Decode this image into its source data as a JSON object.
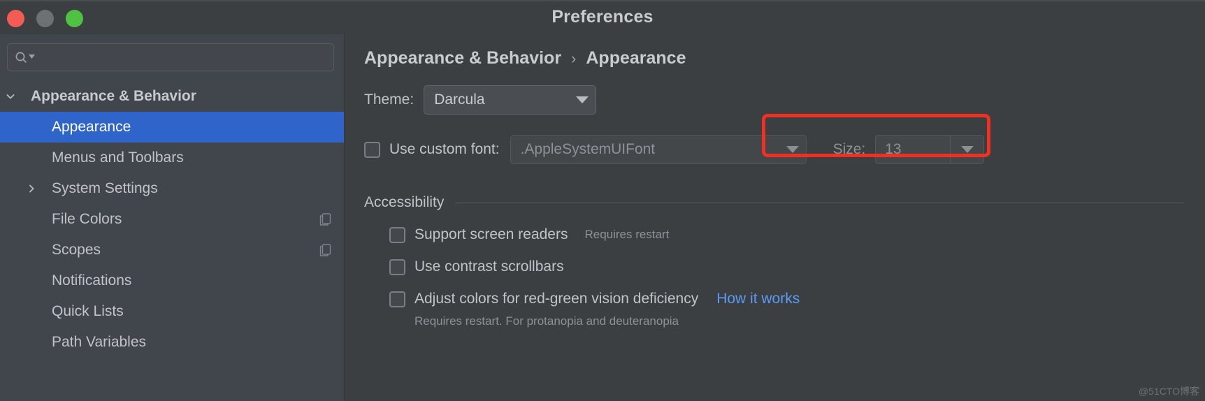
{
  "window": {
    "title": "Preferences",
    "traffic_lights": [
      "close-button",
      "minimize-button",
      "maximize-button"
    ]
  },
  "sidebar": {
    "search": {
      "value": "",
      "placeholder": "",
      "icon": "search-icon"
    },
    "items": [
      {
        "label": "Appearance & Behavior",
        "level": "group",
        "expanded": true,
        "arrow": "chevron-down-icon",
        "selected": false,
        "action_icon": ""
      },
      {
        "label": "Appearance",
        "level": "child",
        "expanded": false,
        "arrow": "",
        "selected": true,
        "action_icon": ""
      },
      {
        "label": "Menus and Toolbars",
        "level": "child",
        "expanded": false,
        "arrow": "",
        "selected": false,
        "action_icon": ""
      },
      {
        "label": "System Settings",
        "level": "child",
        "expanded": false,
        "arrow": "chevron-right-icon",
        "selected": false,
        "action_icon": ""
      },
      {
        "label": "File Colors",
        "level": "child",
        "expanded": false,
        "arrow": "",
        "selected": false,
        "action_icon": "copy-icon"
      },
      {
        "label": "Scopes",
        "level": "child",
        "expanded": false,
        "arrow": "",
        "selected": false,
        "action_icon": "copy-icon"
      },
      {
        "label": "Notifications",
        "level": "child",
        "expanded": false,
        "arrow": "",
        "selected": false,
        "action_icon": ""
      },
      {
        "label": "Quick Lists",
        "level": "child",
        "expanded": false,
        "arrow": "",
        "selected": false,
        "action_icon": ""
      },
      {
        "label": "Path Variables",
        "level": "child",
        "expanded": false,
        "arrow": "",
        "selected": false,
        "action_icon": ""
      }
    ]
  },
  "main": {
    "breadcrumb": {
      "parent": "Appearance & Behavior",
      "separator": "›",
      "current": "Appearance"
    },
    "theme": {
      "label": "Theme:",
      "value": "Darcula",
      "options": [
        "Darcula"
      ],
      "highlighted": true,
      "highlight_color": "#ef3124"
    },
    "custom_font": {
      "checkbox_label": "Use custom font:",
      "checked": false,
      "font_value": ".AppleSystemUIFont",
      "size_label": "Size:",
      "size_value": "13"
    },
    "accessibility": {
      "section_title": "Accessibility",
      "options": [
        {
          "label": "Support screen readers",
          "checked": false,
          "hint": "Requires restart",
          "link": "",
          "subhint": ""
        },
        {
          "label": "Use contrast scrollbars",
          "checked": false,
          "hint": "",
          "link": "",
          "subhint": ""
        },
        {
          "label": "Adjust colors for red-green vision deficiency",
          "checked": false,
          "hint": "",
          "link": "How it works",
          "subhint": "Requires restart. For protanopia and deuteranopia"
        }
      ]
    }
  },
  "watermark": "@51CTO博客",
  "colors": {
    "accent": "#2f65cb",
    "annotation": "#ef3124",
    "link": "#5b9bf5",
    "sidebar_bg": "#41454c",
    "panel_bg": "#3c3f41"
  }
}
